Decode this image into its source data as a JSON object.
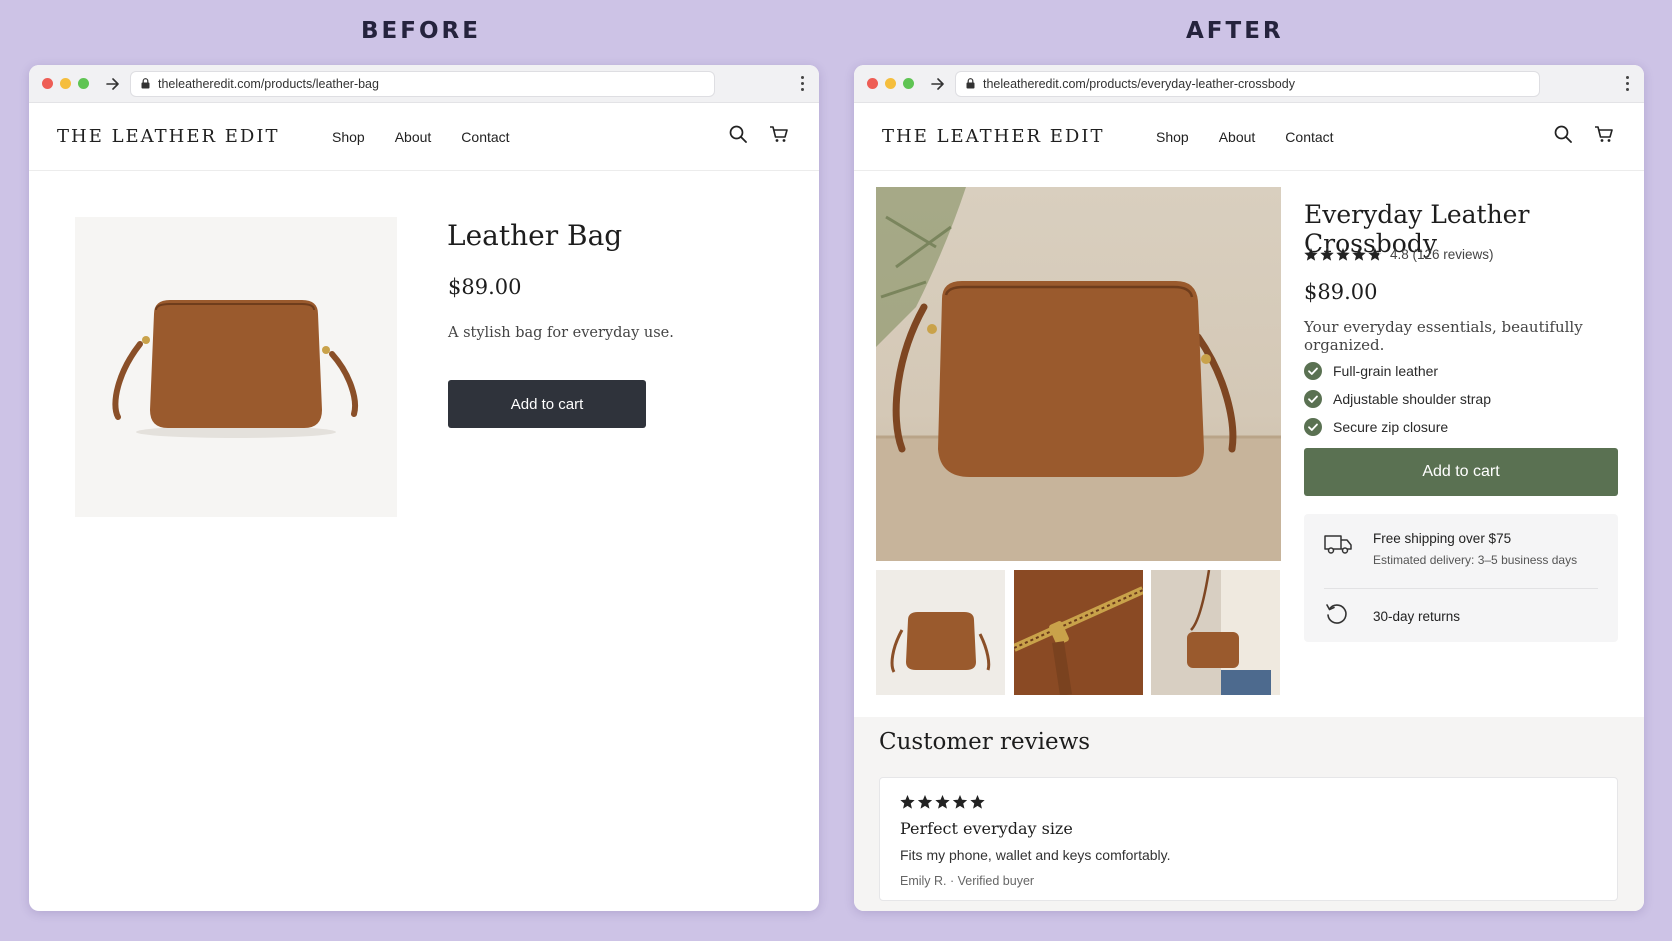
{
  "labels": {
    "before": "BEFORE",
    "after": "AFTER"
  },
  "colors": {
    "background": "#cdc3e6",
    "before_button": "#2f333b",
    "after_button": "#5a7152",
    "leather": "#9a5a2d"
  },
  "before": {
    "url": "theleatheredit.com/products/leather-bag",
    "brand": "THE LEATHER EDIT",
    "nav": [
      "Shop",
      "About",
      "Contact"
    ],
    "product": {
      "title": "Leather Bag",
      "price": "$89.00",
      "description": "A stylish bag for everyday use.",
      "cta": "Add to cart"
    }
  },
  "after": {
    "url": "theleatheredit.com/products/everyday-leather-crossbody",
    "brand": "THE LEATHER EDIT",
    "nav": [
      "Shop",
      "About",
      "Contact"
    ],
    "product": {
      "title": "Everyday Leather Crossbody",
      "rating": 4.8,
      "rating_text": "4.8 (126 reviews)",
      "price": "$89.00",
      "tagline": "Your everyday essentials, beautifully organized.",
      "features": [
        "Full-grain leather",
        "Adjustable shoulder strap",
        "Secure zip closure"
      ],
      "cta": "Add to cart",
      "shipping_title": "Free shipping over $75",
      "shipping_sub": "Estimated delivery: 3–5 business days",
      "returns": "30-day returns"
    },
    "reviews": {
      "heading": "Customer reviews",
      "items": [
        {
          "stars": 5,
          "title": "Perfect everyday size",
          "body": "Fits my phone, wallet and keys comfortably.",
          "author": "Emily R. · Verified buyer"
        }
      ]
    }
  }
}
